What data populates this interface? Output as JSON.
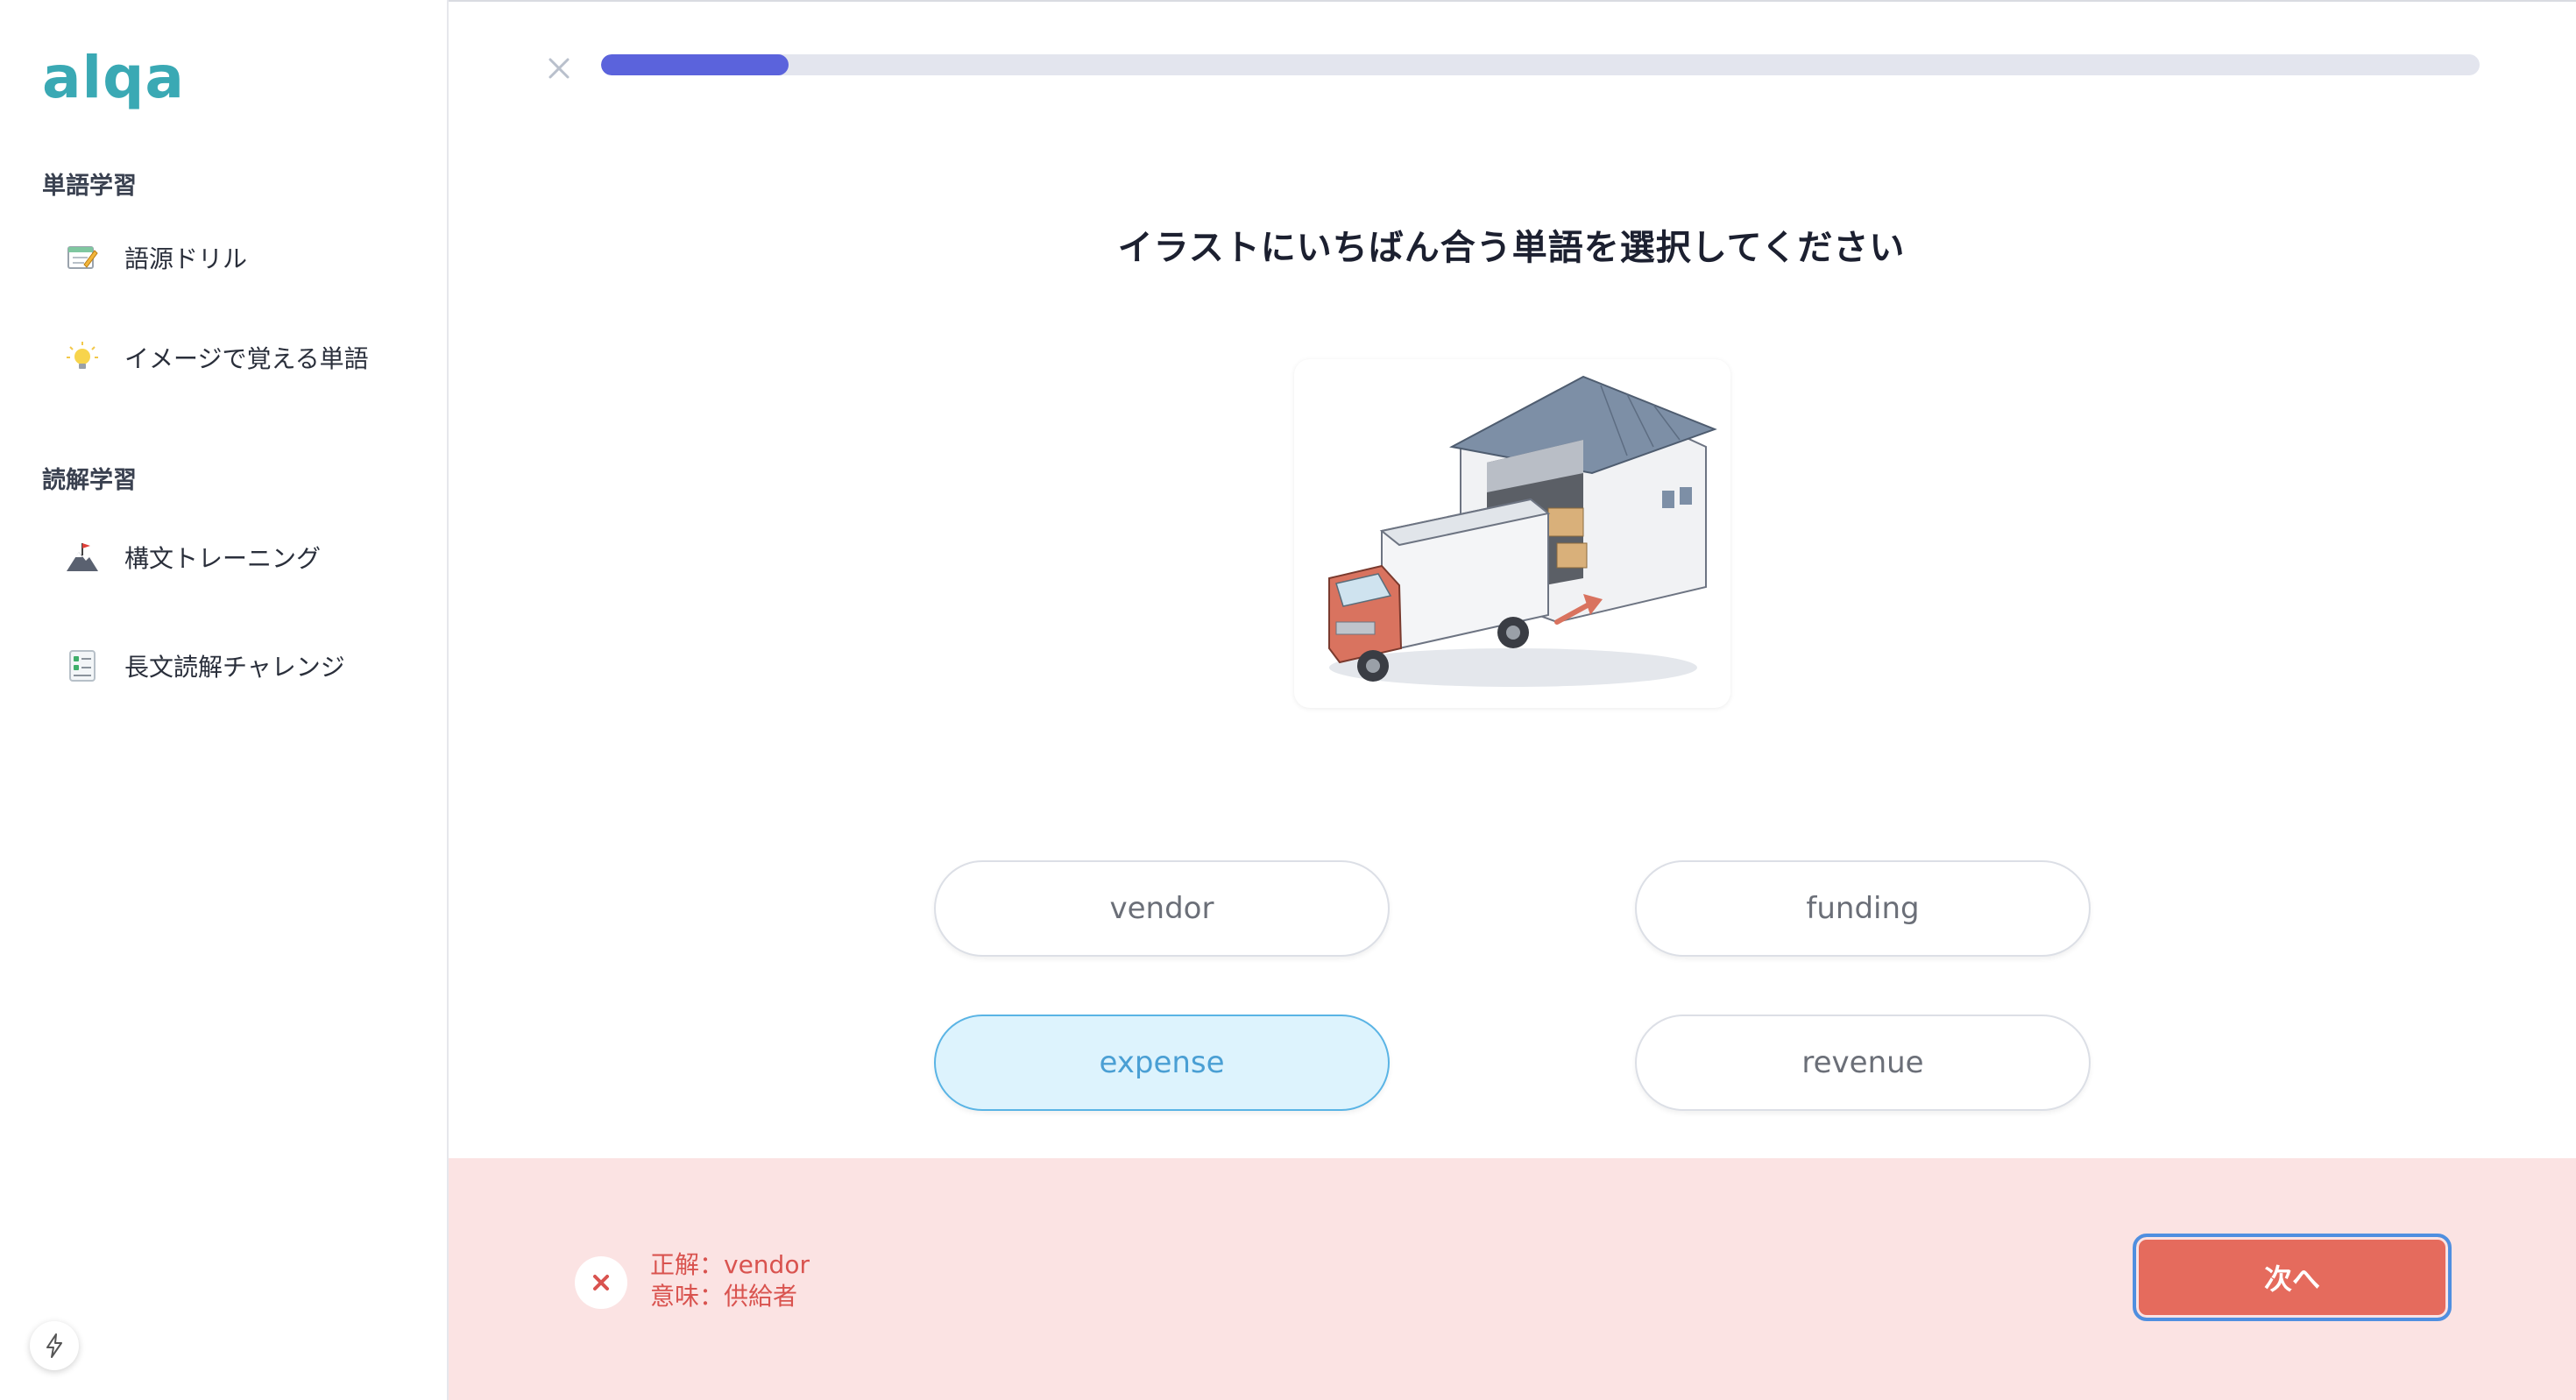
{
  "app": {
    "logo": "alqa"
  },
  "sidebar": {
    "sections": [
      {
        "title": "単語学習",
        "items": [
          {
            "label": "語源ドリル",
            "icon": "memo-icon"
          },
          {
            "label": "イメージで覚える単語",
            "icon": "lightbulb-icon"
          }
        ]
      },
      {
        "title": "読解学習",
        "items": [
          {
            "label": "構文トレーニング",
            "icon": "mountain-flag-icon"
          },
          {
            "label": "長文読解チャレンジ",
            "icon": "checklist-icon"
          }
        ]
      }
    ]
  },
  "quiz": {
    "progress_fraction": 0.1,
    "question": "イラストにいちばん合う単語を選択してください",
    "illustration": "warehouse-truck-illustration",
    "choices": [
      {
        "label": "vendor",
        "selected": false
      },
      {
        "label": "funding",
        "selected": false
      },
      {
        "label": "expense",
        "selected": true
      },
      {
        "label": "revenue",
        "selected": false
      }
    ]
  },
  "feedback": {
    "answer_line": "正解：vendor",
    "meaning_line": "意味：供給者",
    "next_label": "次へ"
  },
  "colors": {
    "accent": "#5b63dc",
    "logo": "#3aa9b4",
    "error": "#d9534f",
    "next_button": "#e56b5d",
    "feedback_bg": "#fbe3e3",
    "selected_bg": "#ddf3fd"
  }
}
